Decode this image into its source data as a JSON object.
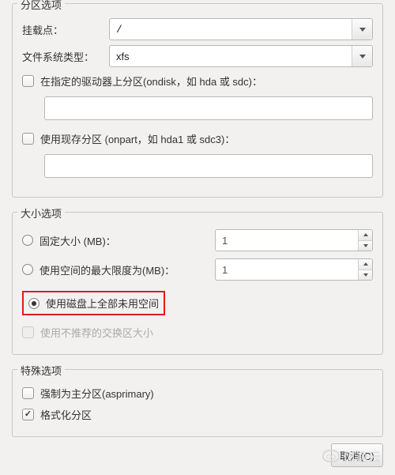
{
  "partition": {
    "legend": "分区选项",
    "mount_label": "挂载点：",
    "mount_value": "/",
    "fs_label": "文件系统类型：",
    "fs_value": "xfs",
    "ondisk_label": "在指定的驱动器上分区(ondisk，如 hda 或 sdc)：",
    "onpart_label": "使用现存分区 (onpart，如 hda1 或 sdc3)："
  },
  "size": {
    "legend": "大小选项",
    "fixed_label": "固定大小 (MB)：",
    "fixed_value": "1",
    "max_label": "使用空间的最大限度为(MB)：",
    "max_value": "1",
    "fill_label": "使用磁盘上全部未用空间",
    "swap_label": "使用不推荐的交换区大小"
  },
  "special": {
    "legend": "特殊选项",
    "asprimary_label": "强制为主分区(asprimary)",
    "format_label": "格式化分区"
  },
  "buttons": {
    "cancel": "取消(C)"
  },
  "watermark": "亿速云"
}
